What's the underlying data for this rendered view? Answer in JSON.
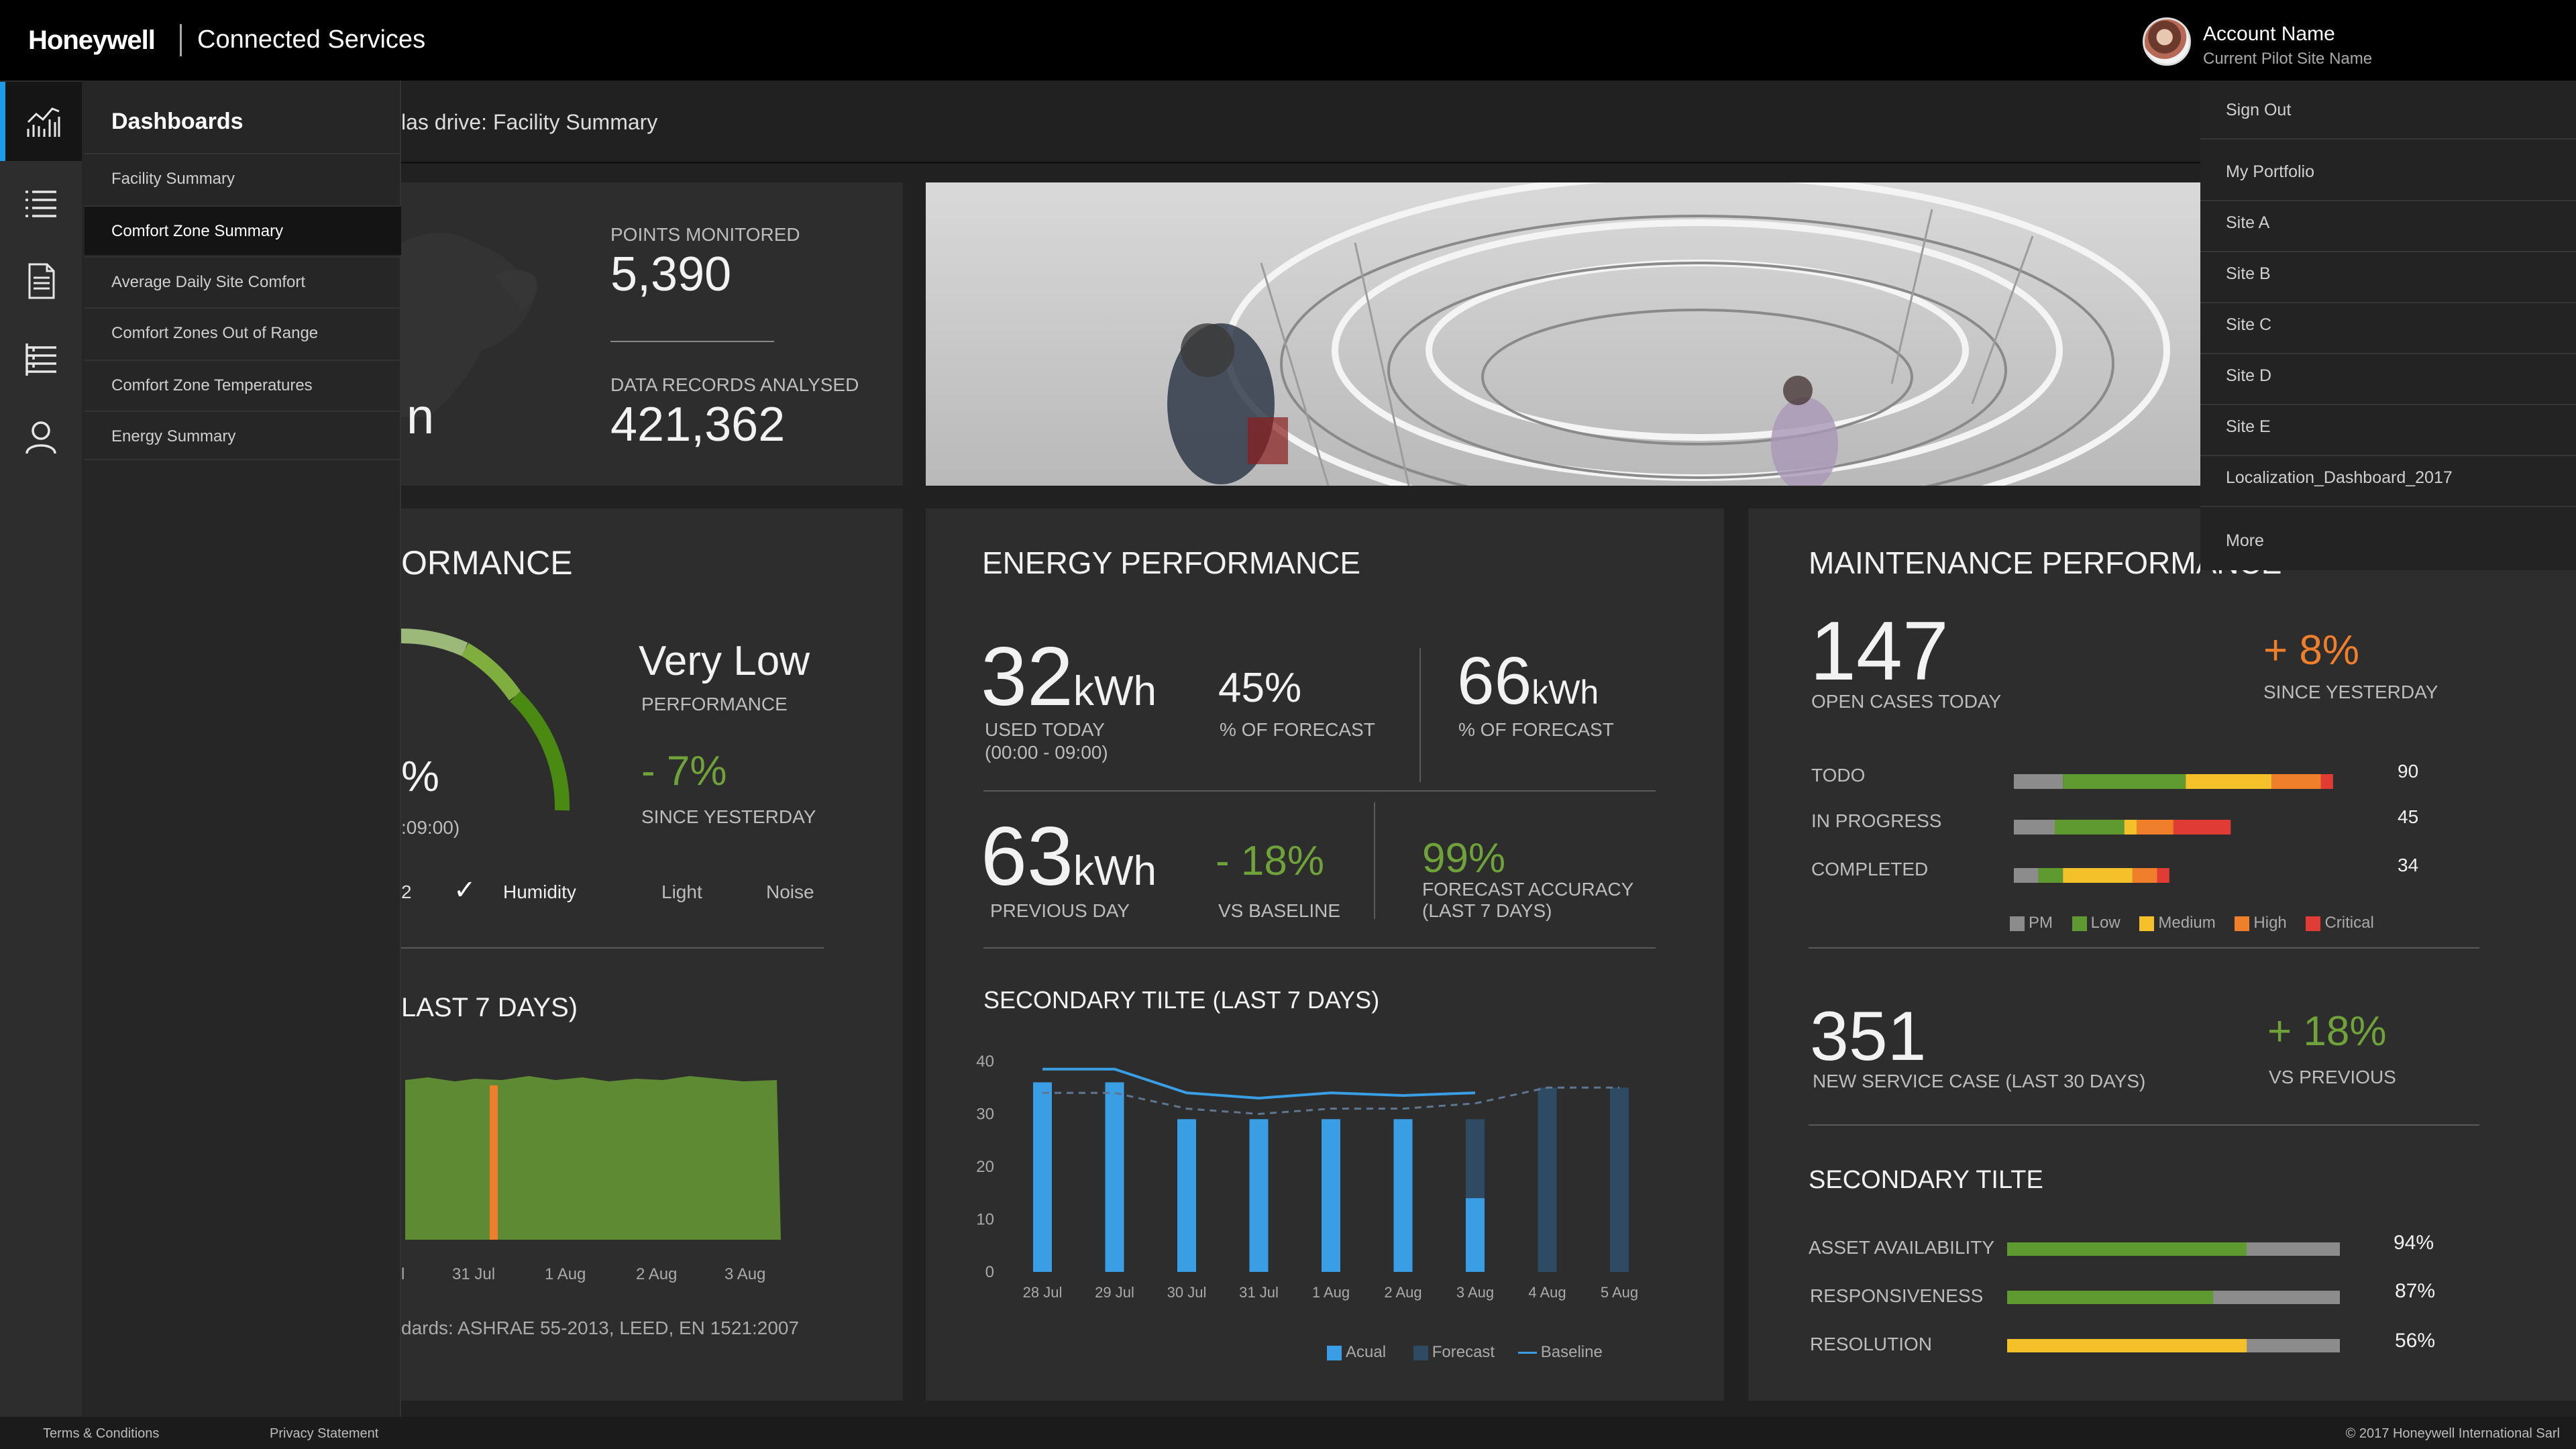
{
  "header": {
    "brand": "Honeywell",
    "app_title": "Connected Services",
    "account_name": "Account Name",
    "site_name": "Current Pilot Site Name"
  },
  "rail": {
    "icons": [
      "chart-icon",
      "list-icon",
      "document-icon",
      "checklist-icon",
      "user-icon"
    ]
  },
  "dashboards_menu": {
    "title": "Dashboards",
    "items": [
      "Facility Summary",
      "Comfort Zone Summary",
      "Average Daily Site Comfort",
      "Comfort Zones Out of Range",
      "Comfort Zone Temperatures",
      "Energy Summary"
    ],
    "selected": "Comfort Zone Summary"
  },
  "breadcrumb": "las drive: Facility Summary",
  "account_menu": {
    "sign_out": "Sign Out",
    "my_portfolio": "My Portfolio",
    "sites": [
      "Site A",
      "Site B",
      "Site C",
      "Site D",
      "Site E",
      "Localization_Dashboard_2017"
    ],
    "more": "More"
  },
  "summary": {
    "points_label": "POINTS MONITORED",
    "points_value": "5,390",
    "records_label": "DATA RECORDS ANALYSED",
    "records_value": "421,362",
    "partial_digit": "n"
  },
  "comfort": {
    "title_partial": "ORMANCE",
    "rating": "Very Low",
    "rating_label": "PERFORMANCE",
    "change": "- 7%",
    "change_label": "SINCE YESTERDAY",
    "gauge_value_partial": "%",
    "gauge_time_partial": ":09:00)",
    "tabs_partial": "2",
    "tabs": [
      "Humidity",
      "Light",
      "Noise"
    ],
    "checked_tab": "Humidity",
    "secondary_title_partial": "LAST 7 DAYS)",
    "x_labels_partial": [
      "l",
      "31 Jul",
      "1 Aug",
      "2 Aug",
      "3 Aug"
    ],
    "standards_partial": "dards: ASHRAE 55-2013, LEED, EN 1521:2007",
    "colors": {
      "fill": "#5e8a33",
      "marker": "#ef7f2b"
    }
  },
  "energy": {
    "title": "ENERGY PERFORMANCE",
    "used_value": "32",
    "used_unit": "kWh",
    "used_label": "USED TODAY",
    "used_time": "(00:00 - 09:00)",
    "forecast_pct": "45%",
    "forecast_pct_label": "% OF FORECAST",
    "forecast_value": "66",
    "forecast_unit": "kWh",
    "forecast_value_label": "% OF FORECAST",
    "prev_value": "63",
    "prev_unit": "kWh",
    "prev_label": "PREVIOUS DAY",
    "baseline_change": "- 18%",
    "baseline_label": "VS BASELINE",
    "accuracy": "99%",
    "accuracy_label_1": "FORECAST ACCURACY",
    "accuracy_label_2": "(LAST 7 DAYS)",
    "chart_title": "SECONDARY TILTE (LAST 7 DAYS)",
    "legend": [
      "Acual",
      "Forecast",
      "Baseline"
    ]
  },
  "maintenance": {
    "title": "MAINTENANCE PERFORMANCE",
    "open_cases": "147",
    "open_label": "OPEN CASES TODAY",
    "change": "+ 8%",
    "change_label": "SINCE YESTERDAY",
    "rows": [
      {
        "label": "TODO",
        "value": "90"
      },
      {
        "label": "IN PROGRESS",
        "value": "45"
      },
      {
        "label": "COMPLETED",
        "value": "34"
      }
    ],
    "legend": [
      "PM",
      "Low",
      "Medium",
      "High",
      "Critical"
    ],
    "new_cases": "351",
    "new_label": "NEW SERVICE CASE (LAST 30 DAYS)",
    "new_change": "+ 18%",
    "new_change_label": "VS PREVIOUS",
    "secondary_title": "SECONDARY TILTE",
    "kpis": [
      {
        "label": "ASSET AVAILABILITY",
        "value": "94%"
      },
      {
        "label": "RESPONSIVENESS",
        "value": "87%"
      },
      {
        "label": "RESOLUTION",
        "value": "56%"
      }
    ]
  },
  "footer": {
    "terms": "Terms & Conditions",
    "privacy": "Privacy Statement",
    "copyright": "© 2017 Honeywell International Sarl"
  },
  "colors": {
    "accent_blue": "#1e9be6",
    "bar_blue": "#3a9ee4",
    "forecast_navy": "#2f4a63",
    "green": "#6fa33a",
    "orange": "#ef7f2b",
    "yellow": "#f4c12b",
    "red": "#e03b34",
    "grey": "#8c8c8c"
  },
  "chart_data": [
    {
      "type": "bar",
      "title": "SECONDARY TILTE (LAST 7 DAYS)",
      "categories": [
        "28 Jul",
        "29 Jul",
        "30 Jul",
        "31 Jul",
        "1 Aug",
        "2 Aug",
        "3 Aug",
        "4 Aug",
        "5 Aug"
      ],
      "ylim": [
        0,
        40
      ],
      "yticks": [
        0,
        10,
        20,
        30,
        40
      ],
      "series": [
        {
          "name": "Acual",
          "kind": "bar",
          "values": [
            36,
            36,
            29,
            29,
            29,
            29,
            14,
            null,
            null
          ]
        },
        {
          "name": "Forecast",
          "kind": "bar",
          "values": [
            null,
            null,
            null,
            null,
            null,
            null,
            15,
            35,
            35
          ]
        },
        {
          "name": "Baseline",
          "kind": "dashed-line",
          "values": [
            34,
            34,
            31,
            30,
            31,
            31,
            32,
            35,
            35
          ]
        },
        {
          "kind": "line",
          "values": [
            38.5,
            38.5,
            34,
            33,
            34,
            33.5,
            34,
            null,
            null
          ]
        }
      ]
    },
    {
      "type": "bar",
      "orientation": "horizontal-stacked",
      "categories": [
        "TODO",
        "IN PROGRESS",
        "COMPLETED"
      ],
      "totals": [
        90,
        45,
        34
      ],
      "series": [
        {
          "name": "PM",
          "values": [
            12,
            10,
            6
          ]
        },
        {
          "name": "Low",
          "values": [
            30,
            17,
            6
          ]
        },
        {
          "name": "Medium",
          "values": [
            21,
            3,
            17
          ]
        },
        {
          "name": "High",
          "values": [
            12,
            9,
            6
          ]
        },
        {
          "name": "Critical",
          "values": [
            3,
            14,
            3
          ]
        }
      ]
    },
    {
      "type": "bar",
      "orientation": "horizontal",
      "categories": [
        "ASSET AVAILABILITY",
        "RESPONSIVENESS",
        "RESOLUTION"
      ],
      "values": [
        94,
        87,
        56
      ],
      "fill_fraction": [
        0.72,
        0.62,
        0.72
      ]
    }
  ]
}
